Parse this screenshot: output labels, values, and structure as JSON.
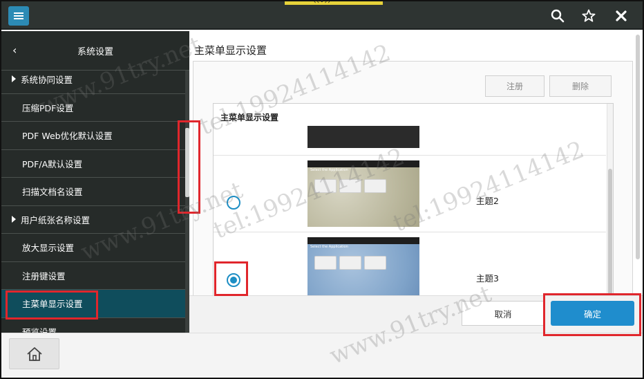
{
  "topbar": {
    "handle_text": "‹‹•››",
    "icons": [
      "menu-icon",
      "search-icon",
      "star-icon",
      "close-icon"
    ]
  },
  "sidebar": {
    "back_icon": "‹",
    "title": "系统设置",
    "items": [
      {
        "label": "系统协同设置",
        "expandable": true
      },
      {
        "label": "压缩PDF设置",
        "expandable": false
      },
      {
        "label": "PDF Web优化默认设置",
        "expandable": false
      },
      {
        "label": "PDF/A默认设置",
        "expandable": false
      },
      {
        "label": "扫描文档名设置",
        "expandable": false
      },
      {
        "label": "用户纸张名称设置",
        "expandable": true
      },
      {
        "label": "放大显示设置",
        "expandable": false
      },
      {
        "label": "注册键设置",
        "expandable": false
      },
      {
        "label": "主菜单显示设置",
        "expandable": false,
        "active": true
      },
      {
        "label": "预览设置",
        "expandable": false
      }
    ]
  },
  "main": {
    "title": "主菜单显示设置",
    "register_label": "注册",
    "delete_label": "删除",
    "list_title": "主菜单显示设置",
    "themes": [
      {
        "name": "主题2",
        "selected": false,
        "thumb_label": "Select the Application"
      },
      {
        "name": "主题3",
        "selected": true,
        "thumb_label": "Select the Application"
      }
    ],
    "cancel_label": "取消",
    "ok_label": "确定"
  },
  "watermark": {
    "tel": "tel:19924114142",
    "site": "www.91try.net"
  },
  "colors": {
    "accent": "#1f8dcd",
    "highlight": "#e0262c",
    "sidebar_bg": "#262b29",
    "active_item": "#0f4d5c"
  }
}
